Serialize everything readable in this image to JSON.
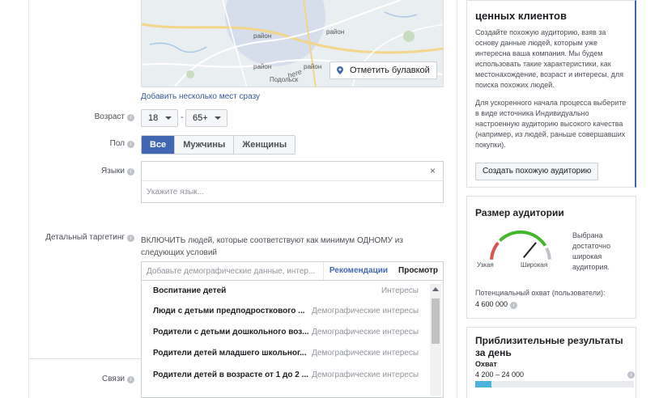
{
  "map": {
    "towns": [
      "район",
      "район",
      "район",
      "район",
      "Подольск"
    ],
    "pin_button_label": "Отметить булавкой",
    "logo_text": "here"
  },
  "targeting": {
    "add_places_link": "Добавить несколько мест сразу",
    "age": {
      "label": "Возраст",
      "min": "18",
      "dash": "-",
      "max": "65+"
    },
    "gender": {
      "label": "Пол",
      "options": [
        "Все",
        "Мужчины",
        "Женщины"
      ],
      "selected": "Все"
    },
    "languages": {
      "label": "Языки",
      "placeholder": "Укажите язык...",
      "clear_icon": "×"
    },
    "detailed": {
      "label": "Детальный таргетинг",
      "include_text": "ВКЛЮЧИТЬ людей, которые соответствуют как минимум ОДНОМУ из следующих условий",
      "search_placeholder": "Добавьте демографические данные, интер...",
      "recommendations_link": "Рекомендации",
      "browse_link": "Просмотр",
      "suggestions": [
        {
          "name": "Воспитание детей",
          "category": "Интересы"
        },
        {
          "name": "Люди с детьми предподросткового ...",
          "category": "Демографические интересы"
        },
        {
          "name": "Родители с детьми дошкольного воз...",
          "category": "Демографические интересы"
        },
        {
          "name": "Родители детей младшего школьног...",
          "category": "Демографические интересы"
        },
        {
          "name": "Родители детей в возрасте от 1 до 2 ...",
          "category": "Демографические интересы"
        }
      ]
    },
    "connections": {
      "label": "Связи"
    },
    "info_glyph": "i"
  },
  "lookalike_card": {
    "title": "ценных клиентов",
    "paragraph1": "Создайте похожую аудиторию, взяв за основу данные людей, которым уже интересна ваша компания. Мы будем использовать такие характеристики, как местонахождение, возраст и интересы, для поиска похожих людей.",
    "paragraph2": "Для ускоренного начала процесса выберите в виде источника Индивидуально настроенную аудиторию высокого качества (например, из людей, раньше совершавших покупки).",
    "button_label": "Создать похожую аудиторию"
  },
  "audience_size": {
    "title": "Размер аудитории",
    "note": "Выбрана достаточно широкая аудитория.",
    "narrow_label": "Узкая",
    "wide_label": "Широкая",
    "gauge_level": 0.72,
    "potential_reach_label": "Потенциальный охват (пользователи):",
    "potential_reach_value": "4 600 000"
  },
  "estimated_results": {
    "title": "Приблизительные результаты за день",
    "metric_label": "Охват",
    "range": "4 200 – 24 000",
    "bar_fraction": 0.1
  },
  "colors": {
    "accent": "#4267b2",
    "gauge_red": "#d9534f",
    "gauge_green": "#42b72a",
    "bar_fill": "#4cb3de"
  }
}
